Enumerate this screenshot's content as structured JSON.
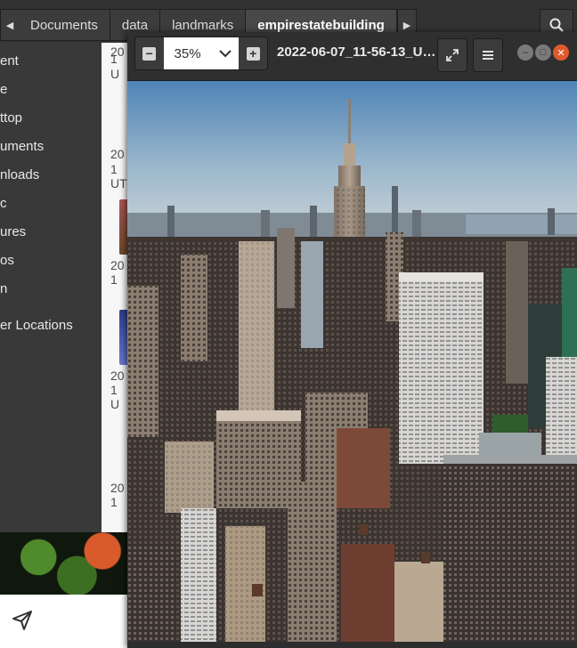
{
  "file_manager": {
    "breadcrumbs": [
      "Documents",
      "data",
      "landmarks",
      "empirestatebuilding"
    ],
    "sidebar_items": [
      "ent",
      "e",
      "ttop",
      "uments",
      "nloads",
      "c",
      "ures",
      "os",
      "n",
      "er Locations"
    ],
    "content_cells": [
      "20",
      "1",
      "U",
      "20",
      "1",
      "UT",
      "20",
      "1",
      "20",
      "1",
      "U",
      "20",
      "1"
    ]
  },
  "viewer": {
    "zoom_value": "35%",
    "title": "2022-06-07_11-56-13_U…"
  },
  "colors": {
    "accent_active_crumb": "#484848",
    "close_button": "#e05a2b"
  }
}
